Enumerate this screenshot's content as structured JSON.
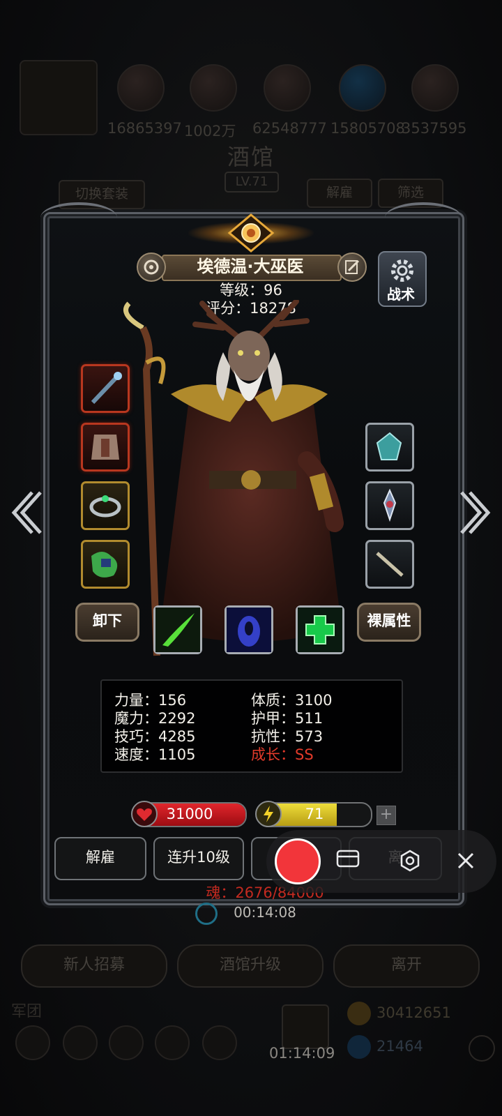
{
  "background": {
    "resources": [
      "16865397",
      "1002万",
      "62548777",
      "15805708",
      "3537595"
    ],
    "tavern_title": "酒馆",
    "tavern_level": "LV.71",
    "switch_set_label": "切换套装",
    "dismiss_label": "解雇",
    "filter_label": "筛选",
    "recruit_label": "新人招募",
    "upgrade_tavern_label": "酒馆升级",
    "leave_label": "离开",
    "corps_label": "军团",
    "gold": "30412651",
    "gems": "21464",
    "timer": "01:14:09"
  },
  "hero": {
    "name": "埃德温·大巫医",
    "level_text": "等级：96",
    "score_text": "评分：18278",
    "tactics_label": "战术",
    "unequip_label": "卸下",
    "bare_attr_label": "裸属性"
  },
  "stats": {
    "strength": "力量：156",
    "magic": "魔力：2292",
    "skill": "技巧：4285",
    "speed": "速度：1105",
    "constitution": "体质：3100",
    "armor": "护甲：511",
    "resistance": "抗性：573",
    "growth": "成长：SS"
  },
  "bars": {
    "hp": "31000",
    "energy": "71",
    "energy_fraction": 0.7,
    "plus": "+"
  },
  "actions": {
    "dismiss": "解雇",
    "levelup10": "连升10级",
    "leave_partial": "离"
  },
  "soul": "魂：2676/84000",
  "countdown": "00:14:08",
  "colors": {
    "hp": "#c8121b",
    "energy": "#d9c321",
    "growth": "#e23a2a",
    "record": "#f2353a"
  },
  "icons": [
    "staff-icon",
    "armor-icon",
    "ring-icon",
    "map-icon",
    "crystal-icon",
    "medal-icon",
    "bone-icon",
    "green-slash-skill-icon",
    "blue-shadow-skill-icon",
    "green-cross-skill-icon",
    "gear-icon",
    "edit-icon",
    "emblem-icon"
  ]
}
